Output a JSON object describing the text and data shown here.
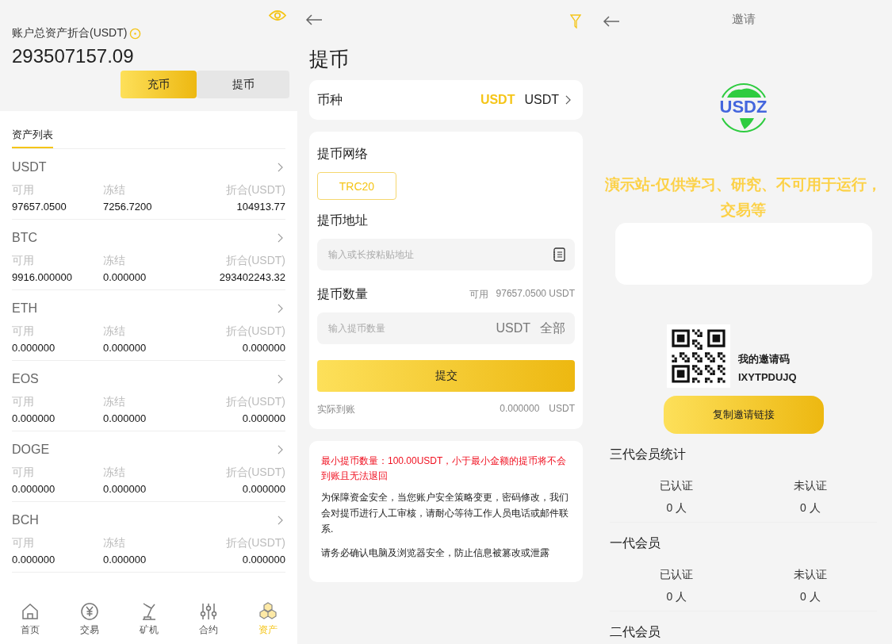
{
  "assets_screen": {
    "total_label": "账户总资产折合(USDT)",
    "total_value": "293507157.09",
    "actions": [
      {
        "label": "充币",
        "selected": true
      },
      {
        "label": "提币",
        "selected": false
      }
    ],
    "list_tab": {
      "label": "资产列表",
      "selected": true
    },
    "assets": [
      {
        "name": "USDT",
        "available_label": "可用",
        "available": "97657.0500",
        "frozen_label": "冻结",
        "frozen": "7256.7200",
        "worth_label": "折合(USDT)",
        "worth": "104913.77"
      },
      {
        "name": "BTC",
        "available_label": "可用",
        "available": "9916.000000",
        "frozen_label": "冻结",
        "frozen": "0.000000",
        "worth_label": "折合(USDT)",
        "worth": "293402243.32"
      },
      {
        "name": "ETH",
        "available_label": "可用",
        "available": "0.000000",
        "frozen_label": "冻结",
        "frozen": "0.000000",
        "worth_label": "折合(USDT)",
        "worth": "0.000000"
      },
      {
        "name": "EOS",
        "available_label": "可用",
        "available": "0.000000",
        "frozen_label": "冻结",
        "frozen": "0.000000",
        "worth_label": "折合(USDT)",
        "worth": "0.000000"
      },
      {
        "name": "DOGE",
        "available_label": "可用",
        "available": "0.000000",
        "frozen_label": "冻结",
        "frozen": "0.000000",
        "worth_label": "折合(USDT)",
        "worth": "0.000000"
      },
      {
        "name": "BCH",
        "available_label": "可用",
        "available": "0.000000",
        "frozen_label": "冻结",
        "frozen": "0.000000",
        "worth_label": "折合(USDT)",
        "worth": "0.000000"
      }
    ],
    "nav": [
      {
        "label": "首页",
        "kind": "home",
        "selected": false
      },
      {
        "label": "交易",
        "kind": "trade",
        "selected": false
      },
      {
        "label": "矿机",
        "kind": "miner",
        "selected": false
      },
      {
        "label": "合约",
        "kind": "contract",
        "selected": false
      },
      {
        "label": "资产",
        "kind": "assets",
        "selected": true
      }
    ]
  },
  "withdraw_screen": {
    "title": "提币",
    "coin_label": "币种",
    "coin_symbol": "USDT",
    "coin_value": "USDT",
    "network_label": "提币网络",
    "networks": [
      {
        "label": "TRC20",
        "selected": true
      }
    ],
    "address_label": "提币地址",
    "address_placeholder": "输入或长按粘贴地址",
    "amount_label": "提币数量",
    "available_label": "可用",
    "available_value": "97657.0500 USDT",
    "amount_placeholder": "输入提币数量",
    "amount_unit": "USDT",
    "all_label": "全部",
    "submit": "提交",
    "received_label": "实际到账",
    "received_value": "0.000000",
    "received_unit": "USDT",
    "warning": "最小提币数量：100.00USDT，小于最小金额的提币将不会到账且无法退回",
    "notes": [
      "为保障资金安全，当您账户安全策略变更，密码修改，我们会对提币进行人工审核，请耐心等待工作人员电话或邮件联系.",
      "请务必确认电脑及浏览器安全，防止信息被篡改或泄露"
    ]
  },
  "invite_screen": {
    "title": "邀请",
    "logo_text": "USDZ",
    "banner": "演示站-仅供学习、研究、不可用于运行，交易等",
    "code_label": "我的邀请码",
    "code": "IXYTPDUJQ",
    "copy_button": "复制邀请链接",
    "stats": [
      {
        "title": "三代会员统计",
        "verified_label": "已认证",
        "verified": "0 人",
        "unverified_label": "未认证",
        "unverified": "0 人"
      },
      {
        "title": "一代会员",
        "verified_label": "已认证",
        "verified": "0 人",
        "unverified_label": "未认证",
        "unverified": "0 人"
      },
      {
        "title": "二代会员"
      }
    ]
  }
}
